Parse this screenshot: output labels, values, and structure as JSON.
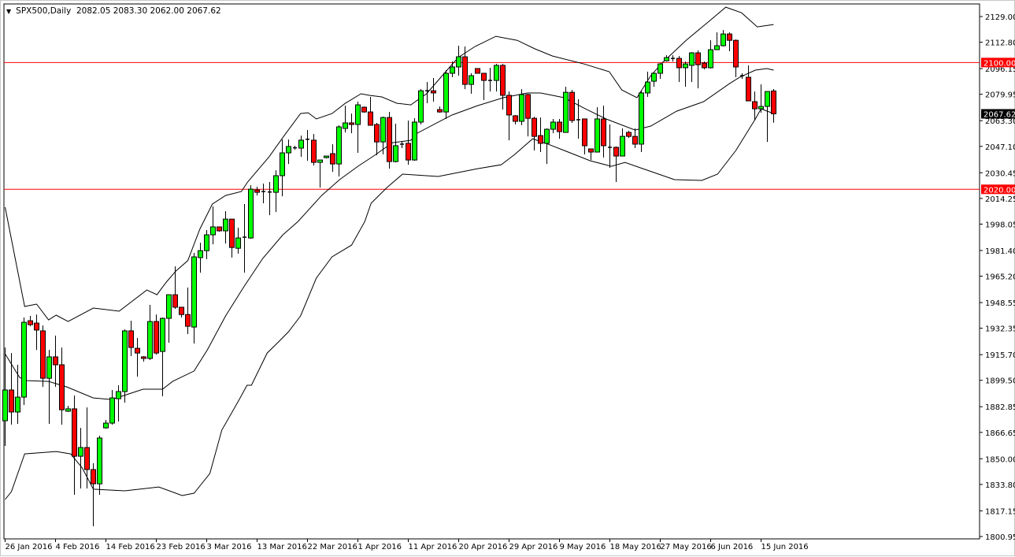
{
  "header": {
    "collapse_icon": "triangle-down-icon",
    "symbol": "SPX500,Daily",
    "ohlc": "2082.05 2083.30 2062.00 2067.62"
  },
  "colors": {
    "bull": "#00ff00",
    "bear": "#ff0000",
    "wick": "#000000",
    "bands": "#000000",
    "hline": "#ff0000",
    "price_label_bg": "#000000"
  },
  "chart_data": {
    "type": "candlestick",
    "title": "SPX500,Daily",
    "ylim": [
      1800.95,
      2129.0
    ],
    "y_ticks": [
      "2129.00",
      "2112.80",
      "2096.15",
      "2079.95",
      "2063.30",
      "2047.10",
      "2030.45",
      "2014.25",
      "1998.05",
      "1981.40",
      "1965.20",
      "1948.55",
      "1932.35",
      "1915.70",
      "1899.50",
      "1882.85",
      "1866.65",
      "1850.00",
      "1833.80",
      "1817.15",
      "1800.95"
    ],
    "x_tick_every_bars": 8,
    "x_ticks": [
      "26 Jan 2016",
      "4 Feb 2016",
      "14 Feb 2016",
      "23 Feb 2016",
      "3 Mar 2016",
      "13 Mar 2016",
      "22 Mar 2016",
      "1 Apr 2016",
      "11 Apr 2016",
      "20 Apr 2016",
      "29 Apr 2016",
      "9 May 2016",
      "18 May 2016",
      "27 May 2016",
      "6 Jun 2016",
      "15 Jun 2016"
    ],
    "horizontal_lines": [
      {
        "value": 2100.0,
        "label": "2100.00"
      },
      {
        "value": 2020.0,
        "label": "2020.00"
      }
    ],
    "last_price": {
      "value": 2067.62,
      "label": "2067.62"
    },
    "ohlc": [
      [
        1874.0,
        1920.2,
        1858.1,
        1893.4
      ],
      [
        1893.4,
        1916.7,
        1871.5,
        1879.5
      ],
      [
        1879.5,
        1909.3,
        1872.0,
        1888.9
      ],
      [
        1888.9,
        1939.1,
        1883.9,
        1936.1
      ],
      [
        1937.1,
        1940.1,
        1933.6,
        1934.6
      ],
      [
        1935.6,
        1941.0,
        1918.7,
        1931.2
      ],
      [
        1930.7,
        1934.1,
        1895.4,
        1900.8
      ],
      [
        1900.8,
        1918.7,
        1872.0,
        1914.3
      ],
      [
        1914.3,
        1927.7,
        1895.4,
        1909.3
      ],
      [
        1909.3,
        1920.2,
        1871.5,
        1880.9
      ],
      [
        1880.0,
        1883.4,
        1879.5,
        1881.5
      ],
      [
        1881.5,
        1889.9,
        1827.3,
        1851.6
      ],
      [
        1851.6,
        1869.5,
        1831.3,
        1857.1
      ],
      [
        1857.1,
        1882.4,
        1831.3,
        1843.2
      ],
      [
        1843.2,
        1847.2,
        1807.4,
        1834.2
      ],
      [
        1834.2,
        1864.6,
        1827.3,
        1863.1
      ],
      [
        1869.5,
        1874.5,
        1869.0,
        1872.5
      ],
      [
        1872.5,
        1893.4,
        1871.5,
        1888.4
      ],
      [
        1887.9,
        1896.4,
        1873.5,
        1892.4
      ],
      [
        1892.4,
        1931.6,
        1885.4,
        1930.7
      ],
      [
        1930.7,
        1937.1,
        1914.8,
        1920.2
      ],
      [
        1919.7,
        1926.2,
        1901.8,
        1916.7
      ],
      [
        1914.3,
        1914.8,
        1911.3,
        1913.3
      ],
      [
        1913.3,
        1947.1,
        1912.3,
        1936.6
      ],
      [
        1936.6,
        1941.0,
        1915.7,
        1916.7
      ],
      [
        1917.7,
        1939.1,
        1889.4,
        1938.6
      ],
      [
        1938.6,
        1953.5,
        1923.2,
        1953.5
      ],
      [
        1953.5,
        1971.4,
        1944.6,
        1945.6
      ],
      [
        1945.6,
        1945.6,
        1939.1,
        1941.0
      ],
      [
        1941.0,
        1958.0,
        1928.7,
        1933.6
      ],
      [
        1933.1,
        1979.9,
        1922.7,
        1977.4
      ],
      [
        1976.9,
        1986.3,
        1967.4,
        1981.3
      ],
      [
        1981.3,
        1994.3,
        1975.9,
        1991.3
      ],
      [
        1991.3,
        2009.2,
        1985.3,
        1996.3
      ],
      [
        1996.3,
        1996.3,
        1993.3,
        1993.8
      ],
      [
        1993.8,
        2006.2,
        1985.8,
        2001.2
      ],
      [
        2001.2,
        2001.2,
        1976.9,
        1983.3
      ],
      [
        1982.8,
        1995.8,
        1979.4,
        1989.3
      ],
      [
        1989.3,
        2010.7,
        1967.4,
        1989.8
      ],
      [
        1989.3,
        2022.6,
        1988.8,
        2020.1
      ],
      [
        2019.6,
        2021.6,
        2016.1,
        2018.1
      ],
      [
        2018.6,
        2023.6,
        2011.2,
        2018.4
      ],
      [
        2018.1,
        2024.6,
        2003.7,
        2018.3
      ],
      [
        2018.1,
        2032.0,
        2005.7,
        2028.6
      ],
      [
        2028.6,
        2051.4,
        2015.6,
        2043.0
      ],
      [
        2043.0,
        2051.4,
        2036.0,
        2047.0
      ],
      [
        2046.0,
        2047.5,
        2045.0,
        2046.2
      ],
      [
        2046.0,
        2053.9,
        2040.5,
        2051.0
      ],
      [
        2051.4,
        2057.4,
        2038.0,
        2051.6
      ],
      [
        2051.0,
        2054.9,
        2035.0,
        2037.0
      ],
      [
        2037.0,
        2038.5,
        2021.1,
        2038.5
      ],
      [
        2040.0,
        2041.0,
        2039.5,
        2041.0
      ],
      [
        2042.5,
        2048.4,
        2031.0,
        2036.0
      ],
      [
        2036.0,
        2060.4,
        2028.1,
        2059.4
      ],
      [
        2058.4,
        2072.8,
        2055.9,
        2061.9
      ],
      [
        2061.9,
        2067.8,
        2055.4,
        2060.9
      ],
      [
        2060.9,
        2075.3,
        2043.0,
        2073.3
      ],
      [
        2071.8,
        2072.3,
        2068.3,
        2068.8
      ],
      [
        2068.8,
        2078.3,
        2060.4,
        2060.4
      ],
      [
        2060.9,
        2061.9,
        2041.5,
        2049.9
      ],
      [
        2049.9,
        2065.8,
        2042.0,
        2065.3
      ],
      [
        2065.3,
        2068.8,
        2033.0,
        2037.5
      ],
      [
        2037.5,
        2061.4,
        2037.0,
        2047.5
      ],
      [
        2048.0,
        2050.4,
        2046.0,
        2048.5
      ],
      [
        2049.0,
        2063.4,
        2035.5,
        2038.5
      ],
      [
        2038.5,
        2064.8,
        2038.0,
        2062.4
      ],
      [
        2062.4,
        2083.2,
        2060.9,
        2082.2
      ],
      [
        2082.2,
        2087.7,
        2074.3,
        2082.0
      ],
      [
        2082.2,
        2090.2,
        2075.3,
        2080.8
      ],
      [
        2070.3,
        2072.3,
        2068.3,
        2068.8
      ],
      [
        2068.8,
        2095.2,
        2064.4,
        2093.2
      ],
      [
        2093.2,
        2100.6,
        2090.7,
        2097.2
      ],
      [
        2097.2,
        2110.6,
        2091.7,
        2103.6
      ],
      [
        2103.6,
        2110.1,
        2083.2,
        2086.2
      ],
      [
        2086.2,
        2093.2,
        2080.3,
        2091.7
      ],
      [
        2096.2,
        2096.2,
        2093.2,
        2093.2
      ],
      [
        2093.2,
        2093.2,
        2076.3,
        2088.7
      ],
      [
        2088.7,
        2096.7,
        2081.7,
        2088.5
      ],
      [
        2088.7,
        2099.1,
        2081.7,
        2098.2
      ],
      [
        2098.2,
        2099.1,
        2070.3,
        2079.3
      ],
      [
        2079.3,
        2081.7,
        2050.9,
        2066.9
      ],
      [
        2066.4,
        2066.9,
        2060.9,
        2062.9
      ],
      [
        2062.9,
        2083.2,
        2060.4,
        2079.8
      ],
      [
        2079.8,
        2080.3,
        2053.4,
        2064.8
      ],
      [
        2064.8,
        2065.8,
        2044.5,
        2053.4
      ],
      [
        2053.9,
        2065.3,
        2043.5,
        2049.0
      ],
      [
        2049.0,
        2058.4,
        2036.0,
        2057.9
      ],
      [
        2057.9,
        2064.4,
        2055.4,
        2062.4
      ],
      [
        2062.4,
        2064.4,
        2051.9,
        2056.4
      ],
      [
        2055.9,
        2084.7,
        2055.9,
        2081.2
      ],
      [
        2081.2,
        2082.7,
        2061.9,
        2063.4
      ],
      [
        2063.9,
        2076.8,
        2051.9,
        2063.7
      ],
      [
        2064.4,
        2064.4,
        2042.0,
        2047.5
      ],
      [
        2045.5,
        2045.5,
        2038.5,
        2043.5
      ],
      [
        2043.5,
        2071.8,
        2043.5,
        2064.4
      ],
      [
        2064.4,
        2072.8,
        2040.0,
        2047.5
      ],
      [
        2046.5,
        2060.9,
        2033.5,
        2046.3
      ],
      [
        2046.5,
        2047.0,
        2024.6,
        2041.0
      ],
      [
        2041.0,
        2058.4,
        2041.0,
        2053.4
      ],
      [
        2055.9,
        2056.9,
        2052.4,
        2053.4
      ],
      [
        2053.4,
        2058.4,
        2046.0,
        2048.5
      ],
      [
        2048.5,
        2082.2,
        2043.5,
        2080.8
      ],
      [
        2080.8,
        2094.2,
        2078.3,
        2087.7
      ],
      [
        2088.2,
        2094.2,
        2084.7,
        2093.2
      ],
      [
        2093.2,
        2099.6,
        2089.7,
        2099.1
      ],
      [
        2101.1,
        2104.6,
        2100.6,
        2103.1
      ],
      [
        2102.6,
        2104.6,
        2100.6,
        2102.4
      ],
      [
        2102.6,
        2104.1,
        2087.7,
        2096.7
      ],
      [
        2096.7,
        2100.6,
        2084.7,
        2099.1
      ],
      [
        2098.2,
        2106.6,
        2087.7,
        2106.1
      ],
      [
        2106.1,
        2107.6,
        2083.7,
        2098.6
      ],
      [
        2099.6,
        2100.6,
        2095.7,
        2096.7
      ],
      [
        2096.7,
        2114.0,
        2096.2,
        2108.1
      ],
      [
        2108.1,
        2119.0,
        2108.1,
        2110.6
      ],
      [
        2110.6,
        2120.5,
        2110.1,
        2118.0
      ],
      [
        2118.0,
        2119.0,
        2107.1,
        2114.0
      ],
      [
        2114.0,
        2114.5,
        2090.7,
        2097.2
      ],
      [
        2091.7,
        2093.2,
        2089.7,
        2091.5
      ],
      [
        2090.7,
        2098.2,
        2075.8,
        2075.8
      ],
      [
        2075.3,
        2081.7,
        2063.4,
        2070.8
      ],
      [
        2070.8,
        2086.2,
        2068.3,
        2072.3
      ],
      [
        2072.3,
        2081.7,
        2049.9,
        2081.7
      ],
      [
        2082.05,
        2083.3,
        2062.0,
        2067.62
      ]
    ],
    "bollinger_bands": {
      "upper": [
        [
          0,
          2008.7
        ],
        [
          3.1,
          1946.1
        ],
        [
          5,
          1947.6
        ],
        [
          6.9,
          1937.6
        ],
        [
          8.1,
          1940.6
        ],
        [
          10,
          1936.6
        ],
        [
          14,
          1945.1
        ],
        [
          18.1,
          1943.1
        ],
        [
          22.5,
          1956.5
        ],
        [
          24.1,
          1953.5
        ],
        [
          25.6,
          1961.5
        ],
        [
          27.1,
          1968.4
        ],
        [
          29,
          1975.0
        ],
        [
          30.9,
          1994.8
        ],
        [
          32.9,
          2010.7
        ],
        [
          35,
          2016.1
        ],
        [
          37.5,
          2018.6
        ],
        [
          38.5,
          2024.6
        ],
        [
          41.9,
          2040.5
        ],
        [
          44.4,
          2054.4
        ],
        [
          46.9,
          2067.8
        ],
        [
          48.1,
          2068.3
        ],
        [
          49.4,
          2064.4
        ],
        [
          51.9,
          2067.8
        ],
        [
          54,
          2074.3
        ],
        [
          56.5,
          2080.3
        ],
        [
          57.8,
          2079.3
        ],
        [
          59.8,
          2078.3
        ],
        [
          62.2,
          2074.3
        ],
        [
          64.4,
          2073.3
        ],
        [
          66.9,
          2080.3
        ],
        [
          69.4,
          2091.7
        ],
        [
          71.9,
          2103.1
        ],
        [
          74.6,
          2110.1
        ],
        [
          77.9,
          2116.5
        ],
        [
          81.3,
          2114.0
        ],
        [
          84.1,
          2108.6
        ],
        [
          86.9,
          2104.1
        ],
        [
          91.9,
          2099.1
        ],
        [
          95.9,
          2094.2
        ],
        [
          97.9,
          2082.7
        ],
        [
          100.3,
          2077.8
        ],
        [
          102.5,
          2091.7
        ],
        [
          104.4,
          2100.1
        ],
        [
          108.1,
          2114.0
        ],
        [
          111.9,
          2126.5
        ],
        [
          114.4,
          2134.9
        ],
        [
          116.9,
          2131.4
        ],
        [
          119.4,
          2122.5
        ],
        [
          122,
          2124.0
        ]
      ],
      "middle": [
        [
          0,
          1916.2
        ],
        [
          2.3,
          1901.3
        ],
        [
          3.5,
          1899.3
        ],
        [
          6.9,
          1898.8
        ],
        [
          9.75,
          1895.4
        ],
        [
          14,
          1888.4
        ],
        [
          16.9,
          1887.4
        ],
        [
          18.5,
          1889.4
        ],
        [
          21.9,
          1893.9
        ],
        [
          25,
          1893.9
        ],
        [
          26.6,
          1898.8
        ],
        [
          30,
          1905.4
        ],
        [
          32.1,
          1918.7
        ],
        [
          35,
          1940.1
        ],
        [
          37.9,
          1958.5
        ],
        [
          40.9,
          1976.4
        ],
        [
          44.1,
          1991.3
        ],
        [
          46.5,
          1999.7
        ],
        [
          50.25,
          2016.1
        ],
        [
          53.1,
          2026.1
        ],
        [
          56,
          2034.5
        ],
        [
          58.5,
          2041.0
        ],
        [
          61.5,
          2049.4
        ],
        [
          64.4,
          2050.9
        ],
        [
          65.4,
          2055.4
        ],
        [
          70.9,
          2066.8
        ],
        [
          75,
          2072.8
        ],
        [
          79.1,
          2077.8
        ],
        [
          82.9,
          2080.8
        ],
        [
          85,
          2080.8
        ],
        [
          88.75,
          2077.8
        ],
        [
          92.1,
          2070.8
        ],
        [
          95.4,
          2064.4
        ],
        [
          100,
          2057.4
        ],
        [
          102.5,
          2059.9
        ],
        [
          106.6,
          2069.3
        ],
        [
          110.9,
          2075.3
        ],
        [
          115,
          2086.7
        ],
        [
          116.6,
          2090.7
        ],
        [
          119.1,
          2095.2
        ],
        [
          120.9,
          2096.2
        ],
        [
          122,
          2095.2
        ]
      ],
      "lower": [
        [
          0,
          1824.3
        ],
        [
          1,
          1829.3
        ],
        [
          3.1,
          1853.1
        ],
        [
          8.1,
          1854.6
        ],
        [
          10.4,
          1853.1
        ],
        [
          12.25,
          1844.2
        ],
        [
          14,
          1830.8
        ],
        [
          19,
          1829.8
        ],
        [
          24.4,
          1832.2
        ],
        [
          28.1,
          1826.8
        ],
        [
          30,
          1828.3
        ],
        [
          32.5,
          1840.7
        ],
        [
          34.4,
          1868.1
        ],
        [
          37.1,
          1886.9
        ],
        [
          38.4,
          1896.4
        ],
        [
          39.1,
          1896.4
        ],
        [
          41.6,
          1916.7
        ],
        [
          43.4,
          1923.7
        ],
        [
          45,
          1930.2
        ],
        [
          46.9,
          1940.1
        ],
        [
          49.4,
          1964.0
        ],
        [
          51.9,
          1977.4
        ],
        [
          55,
          1984.8
        ],
        [
          57.1,
          1999.7
        ],
        [
          58.1,
          2011.2
        ],
        [
          60.6,
          2021.1
        ],
        [
          63.1,
          2029.6
        ],
        [
          68.75,
          2028.1
        ],
        [
          75,
          2033.0
        ],
        [
          78.75,
          2035.5
        ],
        [
          80.9,
          2042.0
        ],
        [
          83.75,
          2051.9
        ],
        [
          86.25,
          2048.4
        ],
        [
          88.75,
          2044.5
        ],
        [
          92.9,
          2038.0
        ],
        [
          96.25,
          2034.5
        ],
        [
          98.4,
          2037.0
        ],
        [
          101.25,
          2033.0
        ],
        [
          106.25,
          2026.1
        ],
        [
          110.6,
          2025.6
        ],
        [
          113.1,
          2029.6
        ],
        [
          116,
          2044.5
        ],
        [
          119.1,
          2064.4
        ],
        [
          120,
          2070.8
        ],
        [
          122,
          2067.8
        ]
      ]
    }
  }
}
